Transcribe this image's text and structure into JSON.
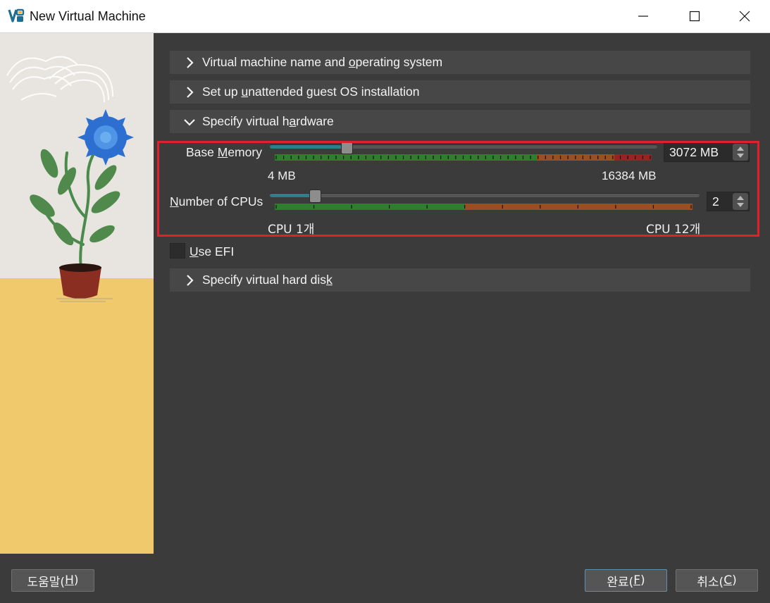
{
  "window": {
    "title": "New Virtual Machine"
  },
  "sections": {
    "name_os": {
      "pre": "Virtual machine name and ",
      "accel": "o",
      "post": "perating system"
    },
    "unattended": {
      "pre": "Set up ",
      "accel": "u",
      "post": "nattended guest OS installation"
    },
    "hardware": {
      "pre": "Specify virtual h",
      "accel": "a",
      "post": "rdware"
    },
    "hard_disk": {
      "pre": "Specify virtual hard dis",
      "accel": "k",
      "post": ""
    }
  },
  "memory": {
    "label_pre": "Base ",
    "label_accel": "M",
    "label_post": "emory",
    "value": "3072 MB",
    "min_label": "4 MB",
    "max_label": "16384 MB",
    "min": 4,
    "max": 16384,
    "current": 3072
  },
  "cpus": {
    "label_accel": "N",
    "label_post": "umber of CPUs",
    "value": "2",
    "min_label": "CPU 1개",
    "max_label": "CPU 12개",
    "min": 1,
    "max": 12,
    "current": 2
  },
  "efi": {
    "accel": "U",
    "post": "se EFI",
    "checked": false
  },
  "buttons": {
    "help": {
      "pre": "도움말(",
      "accel": "H",
      "post": ")"
    },
    "finish": {
      "pre": "완료(",
      "accel": "F",
      "post": ")"
    },
    "cancel": {
      "pre": "취소(",
      "accel": "C",
      "post": ")"
    }
  },
  "colors": {
    "highlight_border": "#e0212c",
    "bar_green": "#2f7d2f",
    "bar_orange": "#9a4f23",
    "bar_red": "#9a2222"
  }
}
